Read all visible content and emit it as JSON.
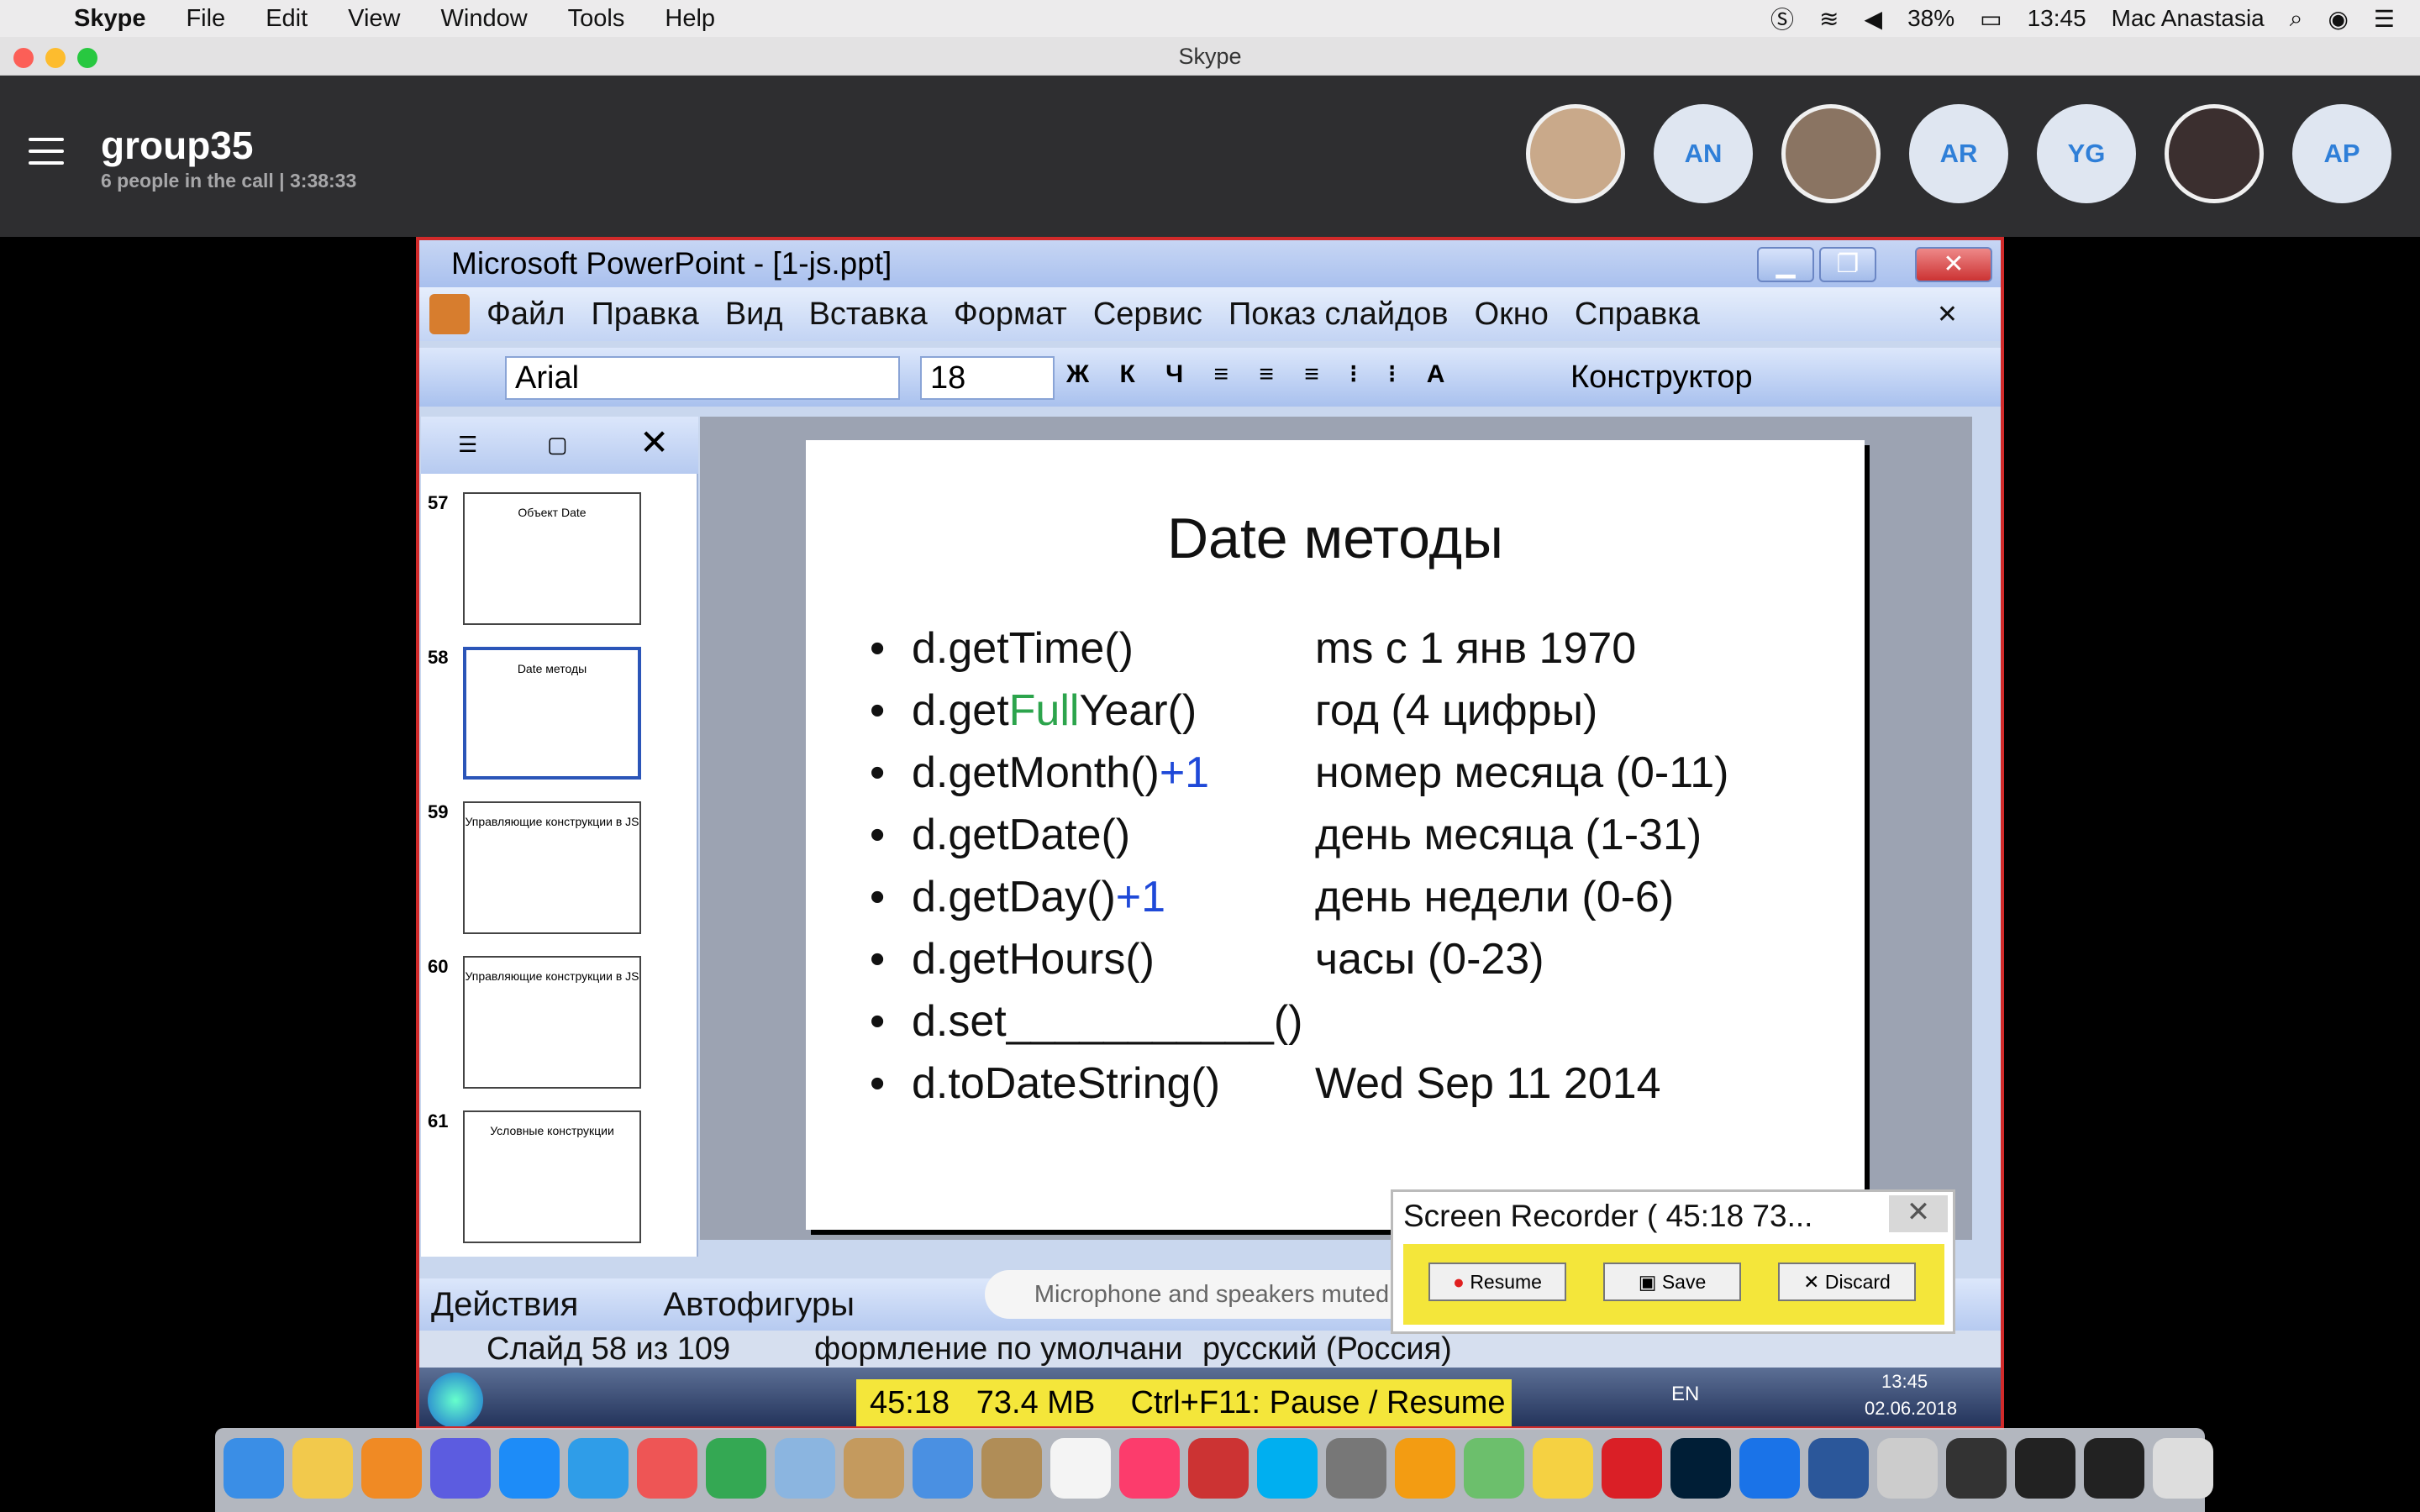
{
  "mac_menu": {
    "app": "Skype",
    "items": [
      "File",
      "Edit",
      "View",
      "Window",
      "Tools",
      "Help"
    ],
    "battery": "38%",
    "time": "13:45",
    "user": "Mac Anastasia"
  },
  "window_title": "Skype",
  "call": {
    "title": "group35",
    "subtitle": "6 people in the call | 3:38:33",
    "participants": [
      "AN",
      "AR",
      "YG",
      "AP"
    ]
  },
  "powerpoint": {
    "title": "Microsoft PowerPoint - [1-js.ppt]",
    "menu": [
      "Файл",
      "Правка",
      "Вид",
      "Вставка",
      "Формат",
      "Сервис",
      "Показ слайдов",
      "Окно",
      "Справка"
    ],
    "font": "Arial",
    "size": "18",
    "designer": "Конструктор",
    "thumbs": [
      {
        "num": "57",
        "title": "Объект Date"
      },
      {
        "num": "58",
        "title": "Date методы"
      },
      {
        "num": "59",
        "title": "Управляющие конструкции в JS"
      },
      {
        "num": "60",
        "title": "Управляющие конструкции в JS"
      },
      {
        "num": "61",
        "title": "Условные конструкции"
      }
    ],
    "slide": {
      "title": "Date методы",
      "rows": [
        {
          "a": "d.getTime()",
          "b": "",
          "cd": "",
          "d": "ms с 1 янв 1970"
        },
        {
          "a": "d.get",
          "b": "Full",
          "cd": "Year()",
          "d": "год (4 цифры)"
        },
        {
          "a": "d.getMonth()",
          "b": "+1",
          "cd": "",
          "d": "номер месяца (0-11)"
        },
        {
          "a": "d.getDate()",
          "b": "",
          "cd": "",
          "d": "день месяца (1-31)"
        },
        {
          "a": "d.getDay()",
          "b": "+1",
          "cd": "",
          "d": "день недели (0-6)"
        },
        {
          "a": "d.getHours()",
          "b": "",
          "cd": "",
          "d": "часы (0-23)"
        },
        {
          "a": "d.set___________()",
          "b": "",
          "cd": "",
          "d": ""
        },
        {
          "a": "d.toDateString()",
          "b": "",
          "cd": "",
          "d": "Wed Sep 11 2014"
        }
      ]
    },
    "draw_actions": "Действия",
    "autoshapes": "Автофигуры",
    "status": {
      "slide": "Слайд 58 из 109",
      "design": "формление по умолчани",
      "lang": "русский (Россия)"
    },
    "taskbar": {
      "timer": "45:18",
      "size": "73.4 MB",
      "hint": "Ctrl+F11: Pause / Resume",
      "lang": "EN",
      "clock_time": "13:45",
      "clock_date": "02.06.2018"
    }
  },
  "mic_status": "Microphone and speakers muted",
  "recorder": {
    "title": "Screen Recorder ( 45:18   73...",
    "resume": "Resume",
    "save": "Save",
    "discard": "Discard"
  }
}
